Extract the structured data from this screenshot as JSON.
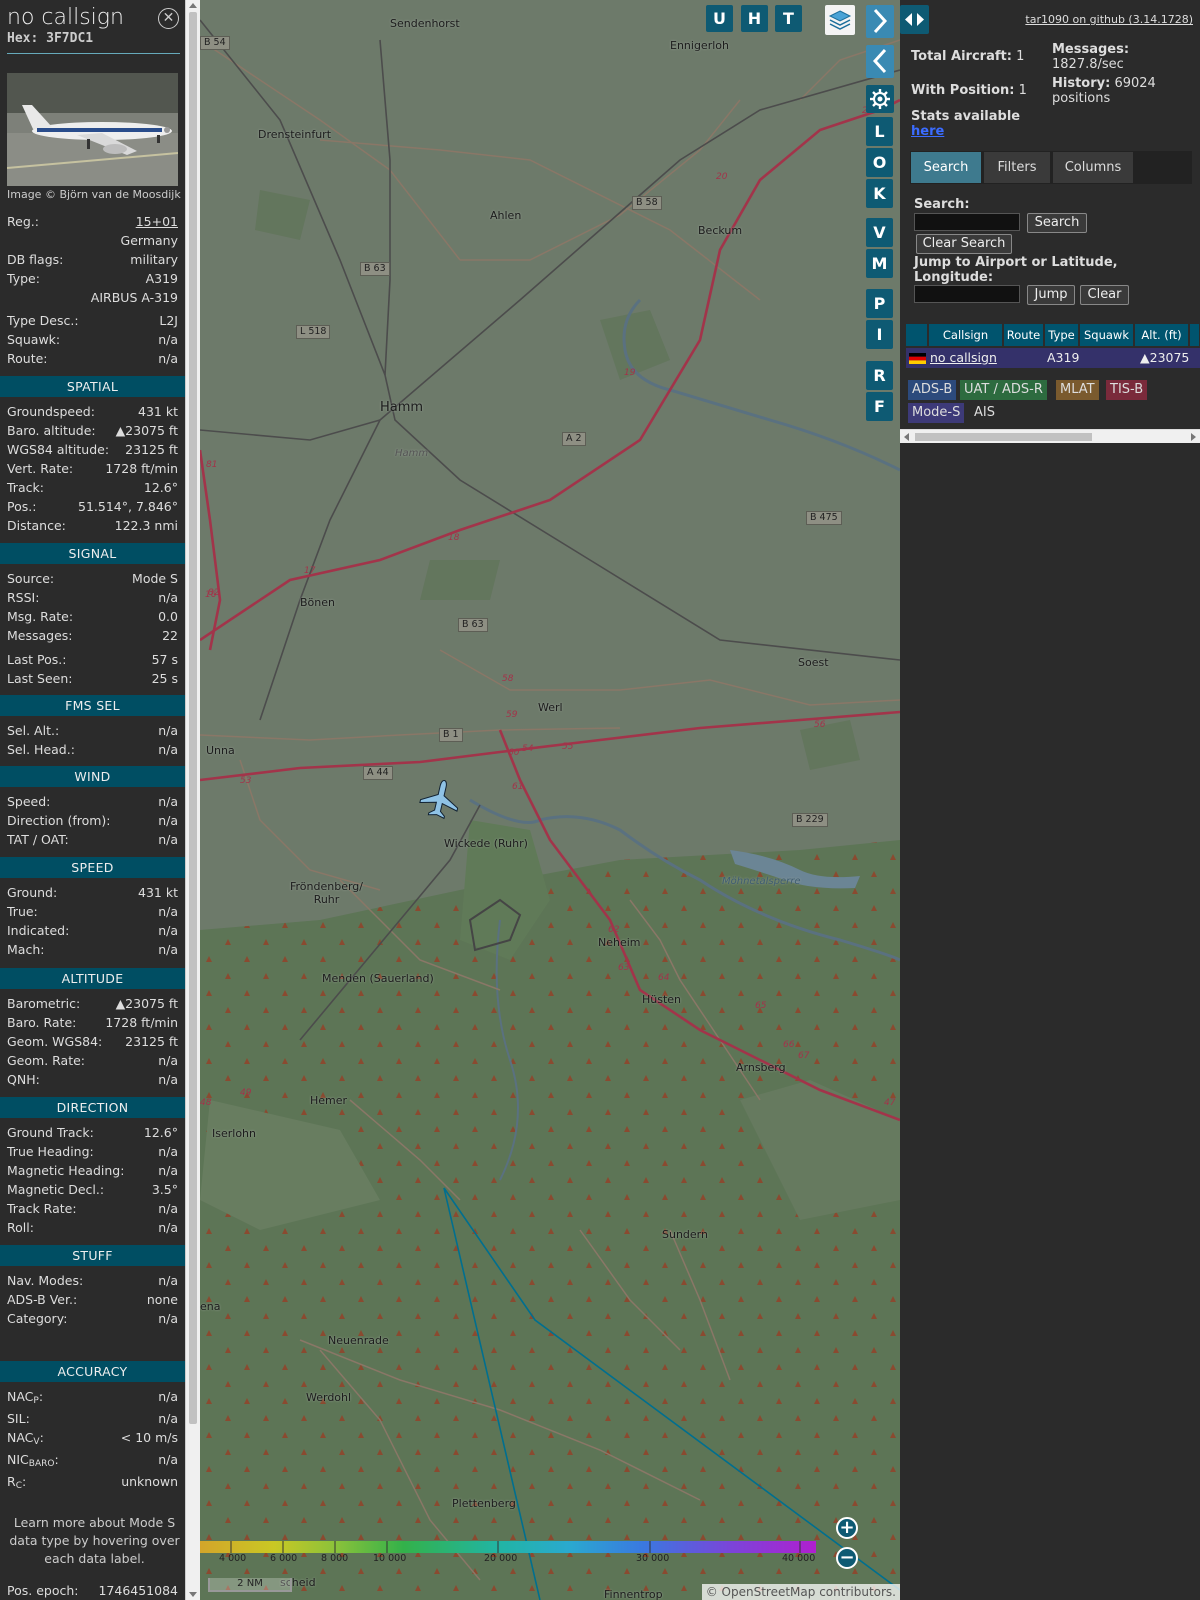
{
  "info": {
    "callsign": "no callsign",
    "hex": "Hex: 3F7DC1",
    "close_icon": "close-icon",
    "photo_credit": "Image © Björn van de Moosdijk",
    "reg_label": "Reg.:",
    "reg": "15+01",
    "country": "Germany",
    "dbflags_label": "DB flags:",
    "dbflags": "military",
    "type_label": "Type:",
    "type": "A319",
    "type_full": "AIRBUS A-319",
    "typedesc_label": "Type Desc.:",
    "typedesc": "L2J",
    "squawk_label": "Squawk:",
    "squawk": "n/a",
    "route_label": "Route:",
    "route": "n/a",
    "sections": {
      "spatial": "SPATIAL",
      "signal": "SIGNAL",
      "fms": "FMS SEL",
      "wind": "WIND",
      "speed": "SPEED",
      "altitude": "ALTITUDE",
      "direction": "DIRECTION",
      "stuff": "STUFF",
      "accuracy": "ACCURACY"
    },
    "spatial": [
      {
        "label": "Groundspeed:",
        "value": "431 kt"
      },
      {
        "label": "Baro. altitude:",
        "value": "▲23075 ft"
      },
      {
        "label": "WGS84 altitude:",
        "value": "23125 ft"
      },
      {
        "label": "Vert. Rate:",
        "value": "1728 ft/min"
      },
      {
        "label": "Track:",
        "value": "12.6°"
      },
      {
        "label": "Pos.:",
        "value": "51.514°, 7.846°"
      },
      {
        "label": "Distance:",
        "value": "122.3 nmi"
      }
    ],
    "signal": [
      {
        "label": "Source:",
        "value": "Mode S"
      },
      {
        "label": "RSSI:",
        "value": "n/a"
      },
      {
        "label": "Msg. Rate:",
        "value": "0.0"
      },
      {
        "label": "Messages:",
        "value": "22"
      },
      {
        "label": "Last Pos.:",
        "value": "57 s"
      },
      {
        "label": "Last Seen:",
        "value": "25 s"
      }
    ],
    "fms": [
      {
        "label": "Sel. Alt.:",
        "value": "n/a"
      },
      {
        "label": "Sel. Head.:",
        "value": "n/a"
      }
    ],
    "wind": [
      {
        "label": "Speed:",
        "value": "n/a"
      },
      {
        "label": "Direction (from):",
        "value": "n/a"
      },
      {
        "label": "TAT / OAT:",
        "value": "n/a"
      }
    ],
    "speed": [
      {
        "label": "Ground:",
        "value": "431 kt"
      },
      {
        "label": "True:",
        "value": "n/a"
      },
      {
        "label": "Indicated:",
        "value": "n/a"
      },
      {
        "label": "Mach:",
        "value": "n/a"
      }
    ],
    "altitude": [
      {
        "label": "Barometric:",
        "value": "▲23075 ft"
      },
      {
        "label": "Baro. Rate:",
        "value": "1728 ft/min"
      },
      {
        "label": "Geom. WGS84:",
        "value": "23125 ft"
      },
      {
        "label": "Geom. Rate:",
        "value": "n/a"
      },
      {
        "label": "QNH:",
        "value": "n/a"
      }
    ],
    "direction": [
      {
        "label": "Ground Track:",
        "value": "12.6°"
      },
      {
        "label": "True Heading:",
        "value": "n/a"
      },
      {
        "label": "Magnetic Heading:",
        "value": "n/a"
      },
      {
        "label": "Magnetic Decl.:",
        "value": "3.5°"
      },
      {
        "label": "Track Rate:",
        "value": "n/a"
      },
      {
        "label": "Roll:",
        "value": "n/a"
      }
    ],
    "stuff": [
      {
        "label": "Nav. Modes:",
        "value": "n/a"
      },
      {
        "label": "ADS-B Ver.:",
        "value": "none"
      },
      {
        "label": "Category:",
        "value": "n/a"
      }
    ],
    "accuracy": [
      {
        "label": "NAC",
        "sub": "P",
        "value": "n/a"
      },
      {
        "label": "SIL:",
        "sub": "",
        "value": "n/a"
      },
      {
        "label": "NAC",
        "sub": "V",
        "value": "< 10 m/s"
      },
      {
        "label": "NIC",
        "sub": "BARO",
        "value": "n/a"
      },
      {
        "label": "R",
        "sub": "C",
        "value": "unknown"
      }
    ],
    "footnote": "Learn more about Mode S data type by hovering over each data label.",
    "epoch_label": "Pos. epoch:",
    "epoch": "1746451084"
  },
  "map": {
    "places": [
      "Sendenhorst",
      "Ennigerloh",
      "Drensteinfurt",
      "Ahlen",
      "Beckum",
      "Hamm",
      "Hamm",
      "Bönen",
      "Soest",
      "Werl",
      "Unna",
      "Wickede (Ruhr)",
      "Fröndenberg/\nRuhr",
      "Neheim",
      "Menden (Sauerland)",
      "Hüsten",
      "Arnsberg",
      "Hemer",
      "Iserlohn",
      "Sundern",
      "Neuenrade",
      "Werdohl",
      "Plettenberg",
      "Finnentrop",
      "Möhnetalsperre",
      "scheid",
      "ena"
    ],
    "roads": [
      "B 54",
      "B 58",
      "B 63",
      "L 518",
      "A 2",
      "B 475",
      "B 63",
      "B 1",
      "A 44",
      "B 229"
    ],
    "junctions": [
      "27",
      "20",
      "19",
      "17",
      "18",
      "81",
      "82",
      "16",
      "59",
      "58",
      "60",
      "61",
      "54",
      "55",
      "56",
      "53",
      "62",
      "63",
      "64",
      "65",
      "66",
      "67",
      "47",
      "48",
      "49"
    ],
    "buttons": [
      "U",
      "H",
      "T",
      "L",
      "O",
      "K",
      "V",
      "M",
      "P",
      "I",
      "R",
      "F"
    ],
    "altitude_scale": [
      "4 000",
      "6 000",
      "8 000",
      "10 000",
      "20 000",
      "30 000",
      "40 000"
    ],
    "scale_label": "2 NM",
    "attribution_prefix": "©",
    "attribution_link": "OpenStreetMap",
    "attribution_suffix": " contributors.",
    "zoom_in": "+",
    "zoom_out": "−",
    "aircraft_icon": "airplane-icon",
    "layers_icon": "layers-icon",
    "settings_icon": "gear-icon",
    "colors": {
      "track": "#006f8f",
      "aircraft": "#8fc3e6"
    }
  },
  "sidebar": {
    "github": "tar1090 on github (3.14.1728)",
    "total_aircraft_label": "Total Aircraft:",
    "total_aircraft": "1",
    "with_position_label": "With Position:",
    "with_position": "1",
    "stats_label": "Stats available",
    "stats_link": "here",
    "messages_label": "Messages:",
    "messages_rate": "1827.8/sec",
    "history_label": "History:",
    "history_value": "69024",
    "history_unit": "positions",
    "tabs": [
      "Search",
      "Filters",
      "Columns"
    ],
    "search_label": "Search:",
    "search_button": "Search",
    "clear_search_button": "Clear Search",
    "jump_label": "Jump to Airport or Latitude, Longitude:",
    "jump_button": "Jump",
    "clear_button": "Clear",
    "columns": [
      "Callsign",
      "Route",
      "Type",
      "Squawk",
      "Alt. (ft)"
    ],
    "row": {
      "callsign": "no callsign",
      "route": "",
      "type": "A319",
      "squawk": "",
      "alt": "▲23075"
    },
    "legend": [
      {
        "label": "ADS-B",
        "color": "#2c4a7c"
      },
      {
        "label": "UAT / ADS-R",
        "color": "#2d6b3f"
      },
      {
        "label": "MLAT",
        "color": "#7a5a2e"
      },
      {
        "label": "TIS-B",
        "color": "#7a2a3b"
      },
      {
        "label": "Mode-S",
        "color": "#3d3a78"
      },
      {
        "label": "AIS",
        "color": "#2b2b2b"
      }
    ]
  }
}
